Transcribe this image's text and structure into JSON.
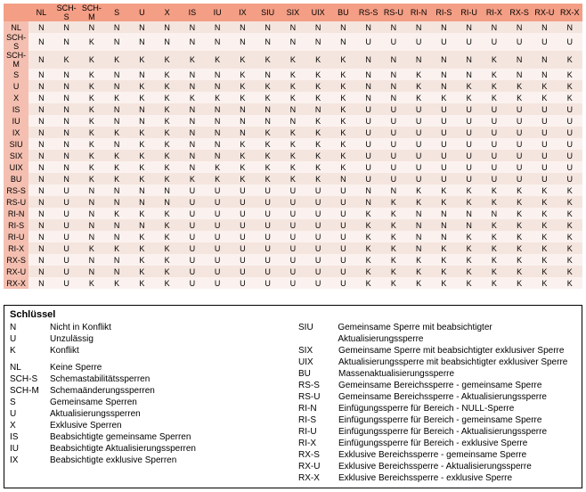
{
  "codes": [
    "NL",
    "SCH-S",
    "SCH-M",
    "S",
    "U",
    "X",
    "IS",
    "IU",
    "IX",
    "SIU",
    "SIX",
    "UIX",
    "BU",
    "RS-S",
    "RS-U",
    "RI-N",
    "RI-S",
    "RI-U",
    "RI-X",
    "RX-S",
    "RX-U",
    "RX-X"
  ],
  "chart_data": {
    "type": "table",
    "rows": [
      "NL",
      "SCH-S",
      "SCH-M",
      "S",
      "U",
      "X",
      "IS",
      "IU",
      "IX",
      "SIU",
      "SIX",
      "UIX",
      "BU",
      "RS-S",
      "RS-U",
      "RI-N",
      "RI-S",
      "RI-U",
      "RI-X",
      "RX-S",
      "RX-U",
      "RX-X"
    ],
    "cols": [
      "NL",
      "SCH-S",
      "SCH-M",
      "S",
      "U",
      "X",
      "IS",
      "IU",
      "IX",
      "SIU",
      "SIX",
      "UIX",
      "BU",
      "RS-S",
      "RS-U",
      "RI-N",
      "RI-S",
      "RI-U",
      "RI-X",
      "RX-S",
      "RX-U",
      "RX-X"
    ],
    "values": [
      [
        "N",
        "N",
        "N",
        "N",
        "N",
        "N",
        "N",
        "N",
        "N",
        "N",
        "N",
        "N",
        "N",
        "N",
        "N",
        "N",
        "N",
        "N",
        "N",
        "N",
        "N",
        "N"
      ],
      [
        "N",
        "N",
        "K",
        "N",
        "N",
        "N",
        "N",
        "N",
        "N",
        "N",
        "N",
        "N",
        "N",
        "U",
        "U",
        "U",
        "U",
        "U",
        "U",
        "U",
        "U",
        "U"
      ],
      [
        "N",
        "K",
        "K",
        "K",
        "K",
        "K",
        "K",
        "K",
        "K",
        "K",
        "K",
        "K",
        "K",
        "N",
        "N",
        "N",
        "N",
        "N",
        "K",
        "N",
        "N",
        "K"
      ],
      [
        "N",
        "N",
        "K",
        "N",
        "N",
        "K",
        "N",
        "N",
        "K",
        "N",
        "K",
        "K",
        "K",
        "N",
        "N",
        "K",
        "N",
        "N",
        "K",
        "N",
        "N",
        "K"
      ],
      [
        "N",
        "N",
        "K",
        "N",
        "K",
        "K",
        "N",
        "N",
        "K",
        "K",
        "K",
        "K",
        "K",
        "N",
        "N",
        "K",
        "N",
        "K",
        "K",
        "K",
        "K",
        "K"
      ],
      [
        "N",
        "N",
        "K",
        "K",
        "K",
        "K",
        "K",
        "K",
        "K",
        "K",
        "K",
        "K",
        "K",
        "N",
        "N",
        "K",
        "K",
        "K",
        "K",
        "K",
        "K",
        "K"
      ],
      [
        "N",
        "N",
        "K",
        "N",
        "N",
        "K",
        "N",
        "N",
        "N",
        "N",
        "N",
        "N",
        "K",
        "U",
        "U",
        "U",
        "U",
        "U",
        "U",
        "U",
        "U",
        "U"
      ],
      [
        "N",
        "N",
        "K",
        "N",
        "N",
        "K",
        "N",
        "N",
        "N",
        "N",
        "N",
        "K",
        "K",
        "U",
        "U",
        "U",
        "U",
        "U",
        "U",
        "U",
        "U",
        "U"
      ],
      [
        "N",
        "N",
        "K",
        "K",
        "K",
        "K",
        "N",
        "N",
        "N",
        "K",
        "K",
        "K",
        "K",
        "U",
        "U",
        "U",
        "U",
        "U",
        "U",
        "U",
        "U",
        "U"
      ],
      [
        "N",
        "N",
        "K",
        "N",
        "K",
        "K",
        "N",
        "N",
        "K",
        "K",
        "K",
        "K",
        "K",
        "U",
        "U",
        "U",
        "U",
        "U",
        "U",
        "U",
        "U",
        "U"
      ],
      [
        "N",
        "N",
        "K",
        "K",
        "K",
        "K",
        "N",
        "N",
        "K",
        "K",
        "K",
        "K",
        "K",
        "U",
        "U",
        "U",
        "U",
        "U",
        "U",
        "U",
        "U",
        "U"
      ],
      [
        "N",
        "N",
        "K",
        "K",
        "K",
        "K",
        "N",
        "K",
        "K",
        "K",
        "K",
        "K",
        "K",
        "U",
        "U",
        "U",
        "U",
        "U",
        "U",
        "U",
        "U",
        "U"
      ],
      [
        "N",
        "N",
        "K",
        "K",
        "K",
        "K",
        "K",
        "K",
        "K",
        "K",
        "K",
        "K",
        "N",
        "U",
        "U",
        "U",
        "U",
        "U",
        "U",
        "U",
        "U",
        "U"
      ],
      [
        "N",
        "U",
        "N",
        "N",
        "N",
        "N",
        "U",
        "U",
        "U",
        "U",
        "U",
        "U",
        "U",
        "N",
        "N",
        "K",
        "K",
        "K",
        "K",
        "K",
        "K",
        "K"
      ],
      [
        "N",
        "U",
        "N",
        "N",
        "N",
        "N",
        "U",
        "U",
        "U",
        "U",
        "U",
        "U",
        "U",
        "N",
        "K",
        "K",
        "K",
        "K",
        "K",
        "K",
        "K",
        "K"
      ],
      [
        "N",
        "U",
        "N",
        "K",
        "K",
        "K",
        "U",
        "U",
        "U",
        "U",
        "U",
        "U",
        "U",
        "K",
        "K",
        "N",
        "N",
        "N",
        "N",
        "K",
        "K",
        "K"
      ],
      [
        "N",
        "U",
        "N",
        "N",
        "N",
        "K",
        "U",
        "U",
        "U",
        "U",
        "U",
        "U",
        "U",
        "K",
        "K",
        "N",
        "N",
        "N",
        "K",
        "K",
        "K",
        "K"
      ],
      [
        "N",
        "U",
        "N",
        "N",
        "K",
        "K",
        "U",
        "U",
        "U",
        "U",
        "U",
        "U",
        "U",
        "K",
        "K",
        "N",
        "N",
        "K",
        "K",
        "K",
        "K",
        "K"
      ],
      [
        "N",
        "U",
        "K",
        "K",
        "K",
        "K",
        "U",
        "U",
        "U",
        "U",
        "U",
        "U",
        "U",
        "K",
        "K",
        "N",
        "K",
        "K",
        "K",
        "K",
        "K",
        "K"
      ],
      [
        "N",
        "U",
        "N",
        "N",
        "K",
        "K",
        "U",
        "U",
        "U",
        "U",
        "U",
        "U",
        "U",
        "K",
        "K",
        "K",
        "K",
        "K",
        "K",
        "K",
        "K",
        "K"
      ],
      [
        "N",
        "U",
        "N",
        "N",
        "K",
        "K",
        "U",
        "U",
        "U",
        "U",
        "U",
        "U",
        "U",
        "K",
        "K",
        "K",
        "K",
        "K",
        "K",
        "K",
        "K",
        "K"
      ],
      [
        "N",
        "U",
        "K",
        "K",
        "K",
        "K",
        "U",
        "U",
        "U",
        "U",
        "U",
        "U",
        "U",
        "K",
        "K",
        "K",
        "K",
        "K",
        "K",
        "K",
        "K",
        "K"
      ]
    ]
  },
  "legend_title": "Schlüssel",
  "legend_left": [
    {
      "k": "N",
      "d": "Nicht in Konflikt"
    },
    {
      "k": "U",
      "d": "Unzulässig"
    },
    {
      "k": "K",
      "d": "Konflikt"
    },
    {
      "k": "",
      "d": ""
    },
    {
      "k": "NL",
      "d": "Keine Sperre"
    },
    {
      "k": "SCH-S",
      "d": "Schemastabilitätssperren"
    },
    {
      "k": "SCH-M",
      "d": "Schemaänderungssperren"
    },
    {
      "k": "S",
      "d": "Gemeinsame Sperren"
    },
    {
      "k": "U",
      "d": "Aktualisierungssperren"
    },
    {
      "k": "X",
      "d": "Exklusive Sperren"
    },
    {
      "k": "IS",
      "d": "Beabsichtigte gemeinsame Sperren"
    },
    {
      "k": "IU",
      "d": "Beabsichtigte Aktualisierungssperren"
    },
    {
      "k": "IX",
      "d": "Beabsichtigte exklusive Sperren"
    }
  ],
  "legend_right": [
    {
      "k": "SIU",
      "d": "Gemeinsame Sperre mit beabsichtigter Aktualisierungssperre"
    },
    {
      "k": "SIX",
      "d": "Gemeinsame Sperre mit beabsichtigter exklusiver Sperre"
    },
    {
      "k": "UIX",
      "d": "Aktualisierungssperre mit beabsichtigter exklusiver Sperre"
    },
    {
      "k": "BU",
      "d": "Massenaktualisierungssperre"
    },
    {
      "k": "RS-S",
      "d": "Gemeinsame Bereichssperre - gemeinsame Sperre"
    },
    {
      "k": "RS-U",
      "d": "Gemeinsame Bereichssperre - Aktualisierungssperre"
    },
    {
      "k": "RI-N",
      "d": "Einfügungssperre für Bereich - NULL-Sperre"
    },
    {
      "k": "RI-S",
      "d": "Einfügungssperre für Bereich - gemeinsame Sperre"
    },
    {
      "k": "RI-U",
      "d": "Einfügungssperre für Bereich - Aktualisierungssperre"
    },
    {
      "k": "RI-X",
      "d": "Einfügungssperre für Bereich - exklusive Sperre"
    },
    {
      "k": "RX-S",
      "d": "Exklusive Bereichssperre - gemeinsame Sperre"
    },
    {
      "k": "RX-U",
      "d": "Exklusive Bereichssperre - Aktualisierungssperre"
    },
    {
      "k": "RX-X",
      "d": "Exklusive Bereichssperre - exklusive Sperre"
    }
  ]
}
